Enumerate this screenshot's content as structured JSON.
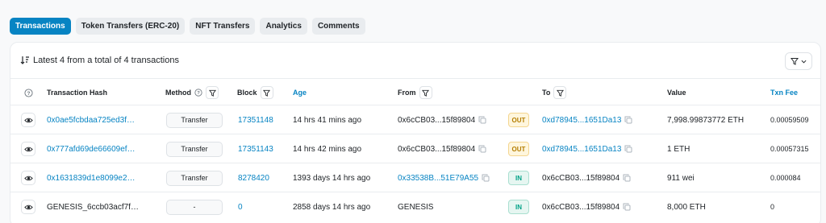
{
  "tabs": [
    {
      "label": "Transactions",
      "active": true
    },
    {
      "label": "Token Transfers (ERC-20)",
      "active": false
    },
    {
      "label": "NFT Transfers",
      "active": false
    },
    {
      "label": "Analytics",
      "active": false
    },
    {
      "label": "Comments",
      "active": false
    }
  ],
  "summary": "Latest 4 from a total of 4 transactions",
  "columns": {
    "hash": "Transaction Hash",
    "method": "Method",
    "block": "Block",
    "age": "Age",
    "from": "From",
    "to": "To",
    "value": "Value",
    "fee": "Txn Fee"
  },
  "rows": [
    {
      "hash": "0x0ae5fcbdaa725ed3f…",
      "method": "Transfer",
      "block": "17351148",
      "age": "14 hrs 41 mins ago",
      "from": "0x6cCB03...15f89804",
      "direction": "OUT",
      "to": "0xd78945...1651Da13",
      "value": "7,998.99873772 ETH",
      "fee": "0.00059509"
    },
    {
      "hash": "0x777afd69de66609ef…",
      "method": "Transfer",
      "block": "17351143",
      "age": "14 hrs 42 mins ago",
      "from": "0x6cCB03...15f89804",
      "direction": "OUT",
      "to": "0xd78945...1651Da13",
      "value": "1 ETH",
      "fee": "0.00057315"
    },
    {
      "hash": "0x1631839d1e8099e2…",
      "method": "Transfer",
      "block": "8278420",
      "age": "1393 days 14 hrs ago",
      "from": "0x33538B...51E79A55",
      "direction": "IN",
      "to": "0x6cCB03...15f89804",
      "value": "911 wei",
      "fee": "0.000084"
    },
    {
      "hash": "GENESIS_6ccb03acf7f…",
      "method": "-",
      "block": "0",
      "age": "2858 days 14 hrs ago",
      "from": "GENESIS",
      "direction": "IN",
      "to": "0x6cCB03...15f89804",
      "value": "8,000 ETH",
      "fee": "0"
    }
  ],
  "colors": {
    "accent": "#0784c3",
    "out": "#b47d00",
    "in": "#00a186"
  }
}
